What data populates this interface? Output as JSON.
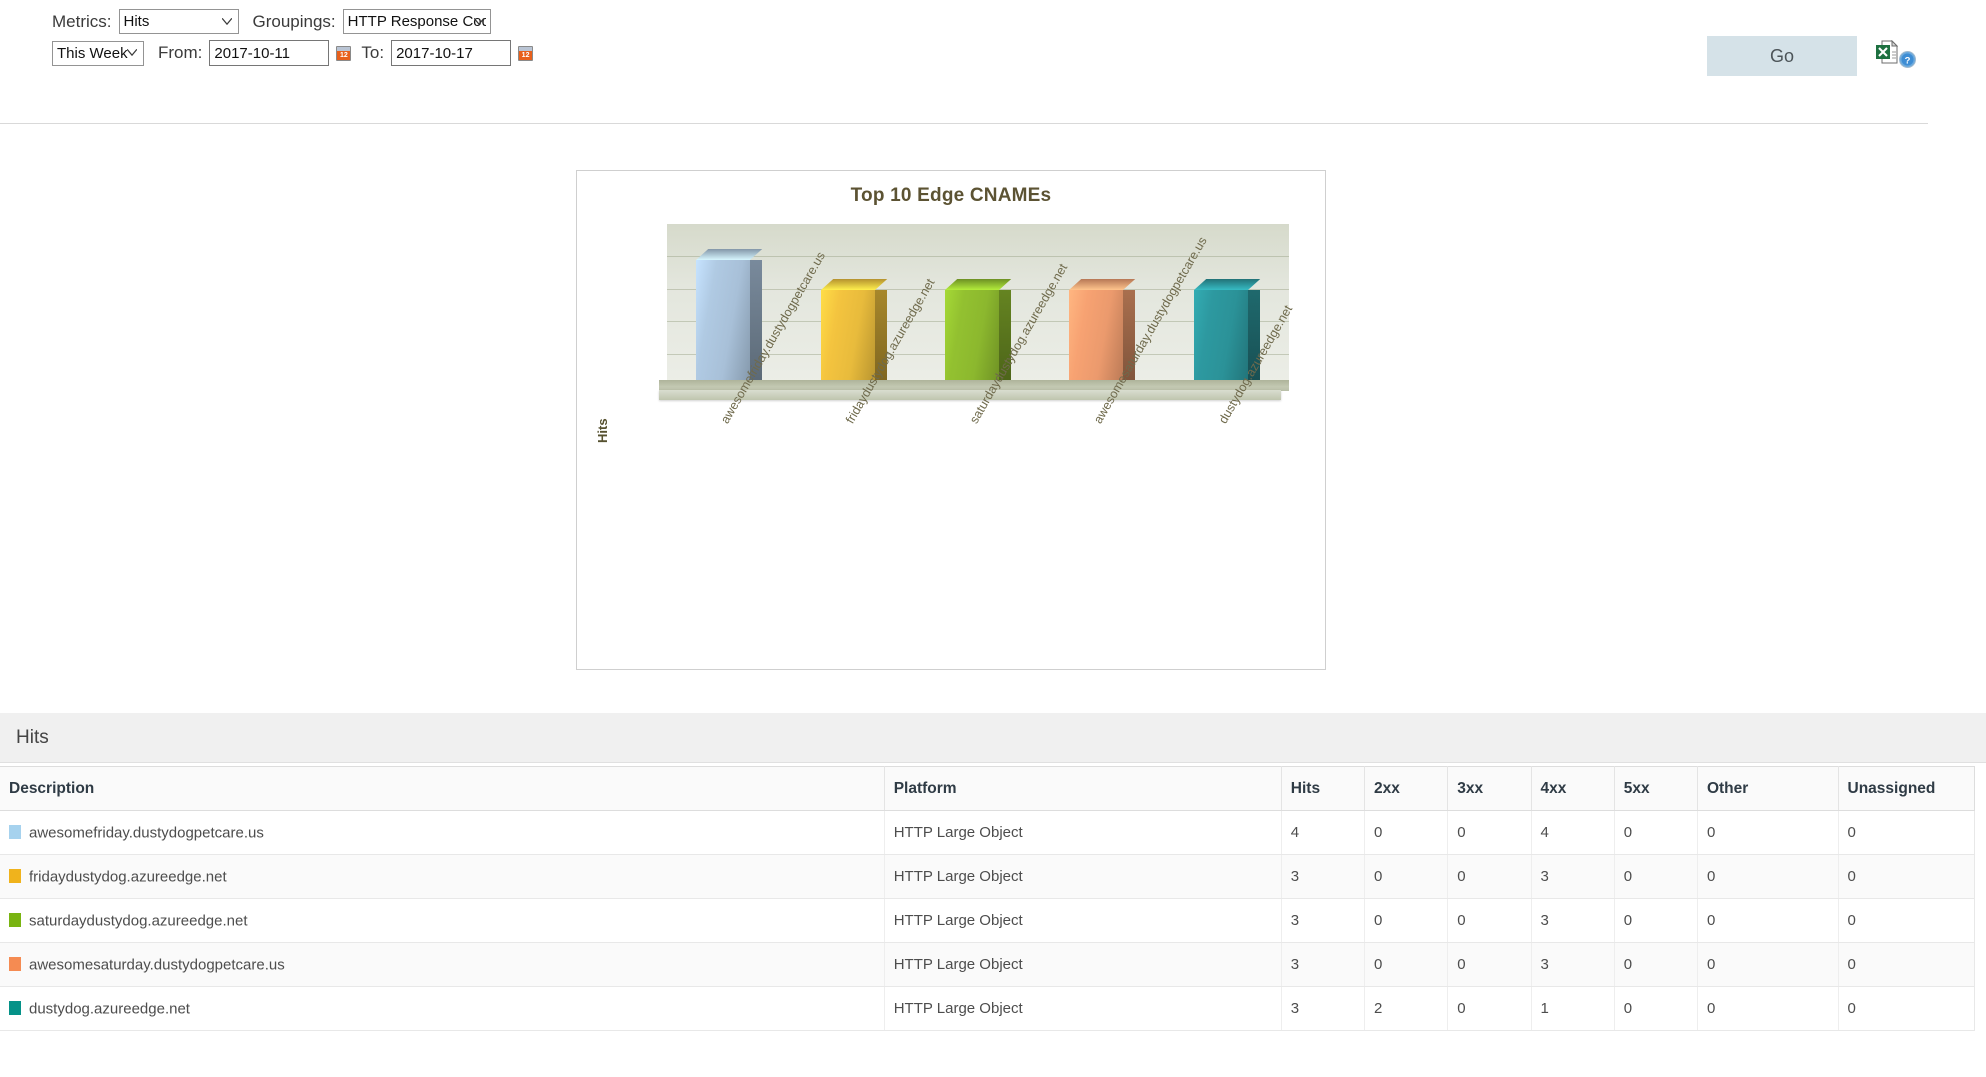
{
  "toolbar": {
    "metrics_label": "Metrics:",
    "metrics_value": "Hits",
    "metrics_options": [
      "Hits"
    ],
    "groupings_label": "Groupings:",
    "groupings_value": "HTTP Response Codes",
    "groupings_options": [
      "HTTP Response Codes"
    ],
    "range_value": "This Week",
    "range_options": [
      "This Week"
    ],
    "from_label": "From:",
    "from_value": "2017-10-11",
    "to_label": "To:",
    "to_value": "2017-10-17",
    "go_label": "Go",
    "excel_icon": "excel-export-icon",
    "help_icon": "help-icon",
    "calendar_icon": "calendar-icon"
  },
  "chart_data": {
    "type": "bar",
    "title": "Top 10 Edge CNAMEs",
    "xlabel": "",
    "ylabel": "Hits",
    "grid": true,
    "legend": "none",
    "ylim": [
      0,
      5
    ],
    "categories": [
      "awesomefriday.dustydogpetcare.us",
      "fridaydustydog.azureedge.net",
      "saturdaydustydog.azureedge.net",
      "awesomesaturday.dustydogpetcare.us",
      "dustydog.azureedge.net"
    ],
    "values": [
      4,
      3,
      3,
      3,
      3
    ],
    "colors": [
      "#a8c0d8",
      "#e8bb3c",
      "#8cb82e",
      "#eb9a6d",
      "#2b9298"
    ]
  },
  "section": {
    "hits_title": "Hits"
  },
  "table": {
    "columns": [
      "Description",
      "Platform",
      "Hits",
      "2xx",
      "3xx",
      "4xx",
      "5xx",
      "Other",
      "Unassigned"
    ],
    "rows": [
      {
        "color": "#a6d2ee",
        "description": "awesomefriday.dustydogpetcare.us",
        "platform": "HTTP Large Object",
        "hits": "4",
        "c2xx": "0",
        "c3xx": "0",
        "c4xx": "4",
        "c5xx": "0",
        "other": "0",
        "unassigned": "0"
      },
      {
        "color": "#f0b31c",
        "description": "fridaydustydog.azureedge.net",
        "platform": "HTTP Large Object",
        "hits": "3",
        "c2xx": "0",
        "c3xx": "0",
        "c4xx": "3",
        "c5xx": "0",
        "other": "0",
        "unassigned": "0"
      },
      {
        "color": "#79b411",
        "description": "saturdaydustydog.azureedge.net",
        "platform": "HTTP Large Object",
        "hits": "3",
        "c2xx": "0",
        "c3xx": "0",
        "c4xx": "3",
        "c5xx": "0",
        "other": "0",
        "unassigned": "0"
      },
      {
        "color": "#f58b52",
        "description": "awesomesaturday.dustydogpetcare.us",
        "platform": "HTTP Large Object",
        "hits": "3",
        "c2xx": "0",
        "c3xx": "0",
        "c4xx": "3",
        "c5xx": "0",
        "other": "0",
        "unassigned": "0"
      },
      {
        "color": "#059288",
        "description": "dustydog.azureedge.net",
        "platform": "HTTP Large Object",
        "hits": "3",
        "c2xx": "2",
        "c3xx": "0",
        "c4xx": "1",
        "c5xx": "0",
        "other": "0",
        "unassigned": "0"
      }
    ]
  }
}
